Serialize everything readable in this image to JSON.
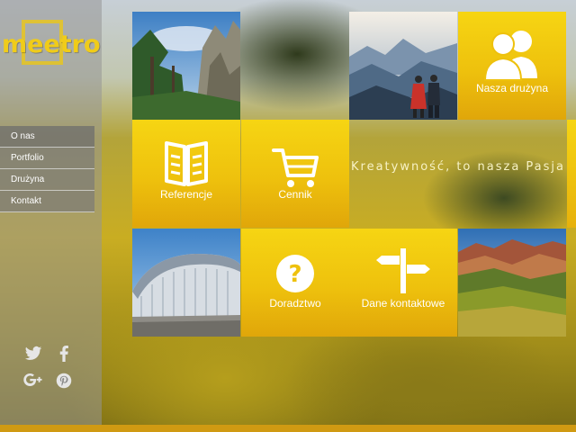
{
  "brand": {
    "logo_text": "meetro"
  },
  "nav": {
    "items": [
      {
        "label": "O nas"
      },
      {
        "label": "Portfolio"
      },
      {
        "label": "Drużyna"
      },
      {
        "label": "Kontakt"
      }
    ]
  },
  "social": {
    "icons": [
      "twitter-icon",
      "facebook-icon",
      "google-plus-icon",
      "pinterest-icon"
    ]
  },
  "tiles": {
    "team": {
      "label": "Nasza drużyna",
      "icon": "users-icon"
    },
    "references": {
      "label": "Referencje",
      "icon": "book-icon"
    },
    "pricing": {
      "label": "Cennik",
      "icon": "cart-icon"
    },
    "advice": {
      "label": "Doradztwo",
      "icon": "question-icon"
    },
    "contact": {
      "label": "Dane kontaktowe",
      "icon": "signpost-icon"
    }
  },
  "slogan": {
    "text": "Kreatywność, to nasza Pasja"
  },
  "colors": {
    "accent": "#f2c90f",
    "accent_dark": "#e0a60a",
    "sidebar": "#969696",
    "bottom_bar": "#d09a12"
  }
}
